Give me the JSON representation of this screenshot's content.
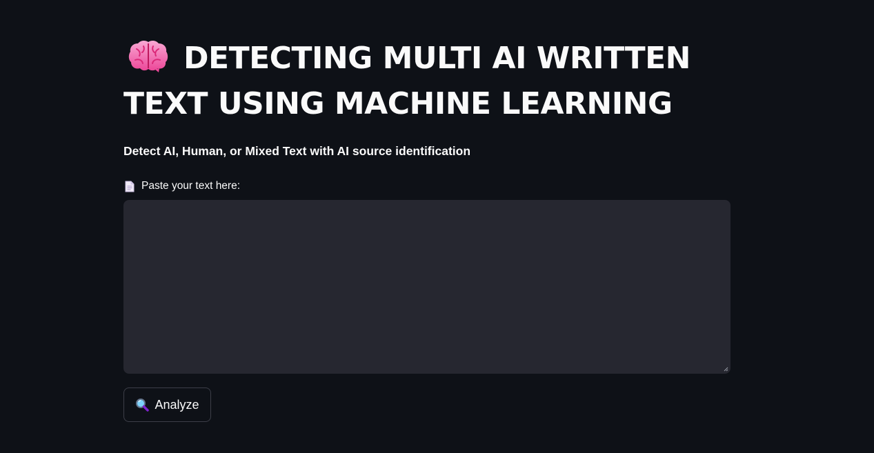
{
  "header": {
    "title_icon": "brain-icon",
    "title_line1": "DETECTING MULTI AI WRITTEN",
    "title_line2": "TEXT USING MACHINE LEARNING",
    "subtitle": "Detect AI, Human, or Mixed Text with AI source identification"
  },
  "input": {
    "label_icon": "document-icon",
    "label": "Paste your text here:",
    "value": "",
    "placeholder": ""
  },
  "actions": {
    "analyze_icon": "magnifying-glass-icon",
    "analyze_label": "Analyze"
  },
  "colors": {
    "background": "#0e1117",
    "text": "#fafafa",
    "input_background": "#262730",
    "button_border": "#3d3f49",
    "brain_pink": "#f472b6"
  }
}
